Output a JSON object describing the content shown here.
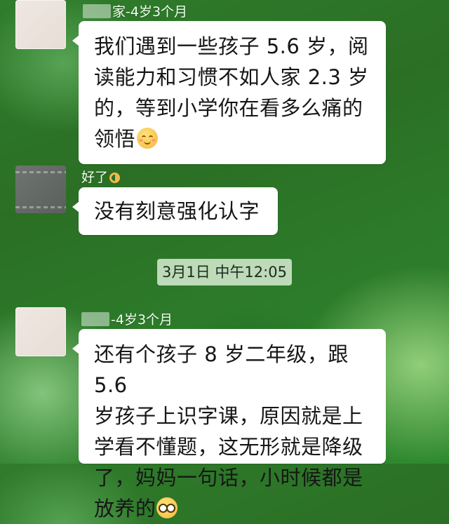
{
  "chat": {
    "messages": [
      {
        "sender": "家-4岁3个月",
        "lines": [
          "我们遇到一些孩子 5.6 岁，阅",
          "读能力和习惯不如人家 2.3 岁",
          "的，等到小学你在看多么痛的",
          "领悟"
        ],
        "emoji": "smiling-face-emoji"
      },
      {
        "sender": "好了",
        "sender_emoji": "ok-hand-emoji",
        "lines": [
          "没有刻意强化认字"
        ]
      },
      {
        "sender": "-4岁3个月",
        "lines": [
          "还有个孩子 8 岁二年级，跟 5.6",
          "岁孩子上识字课，原因就是上",
          "学看不懂题，这无形就是降级",
          "了，妈妈一句话，小时候都是",
          "放养的"
        ],
        "emoji": "face-with-glasses-emoji"
      }
    ],
    "timestamp": "3月1日 中午12:05"
  },
  "colors": {
    "background": "#2c7a2a",
    "bubble": "#ffffff",
    "timestamp_bg": "#d7ebd2"
  }
}
